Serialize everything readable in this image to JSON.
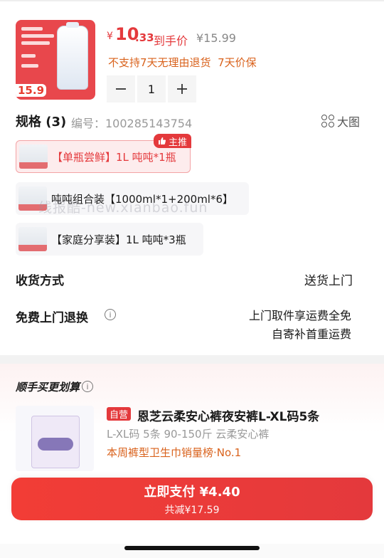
{
  "product": {
    "price_currency": "¥",
    "price_int": "10",
    "price_dec": ".33",
    "price_label": "到手价",
    "orig_price": "¥15.99",
    "tags": "不支持7天无理由退货  7天价保",
    "thumb_price": "15.9",
    "quantity": "1"
  },
  "spec": {
    "title": "规格 (3)",
    "code": "编号：100285143754",
    "big_image_label": "大图",
    "main_badge": "主推",
    "options": [
      {
        "label": "【单瓶尝鲜】1L 吨吨*1瓶"
      },
      {
        "label": "吨吨组合装【1000ml*1+200ml*6】"
      },
      {
        "label": "【家庭分享装】1L 吨吨*3瓶"
      }
    ],
    "watermark": "线报酷-new.xianbao.fun"
  },
  "delivery": {
    "label": "收货方式",
    "value": "送货上门"
  },
  "returns": {
    "label": "免费上门退换",
    "line1": "上门取件享运费全免",
    "line2": "自寄补首重运费"
  },
  "recommend": {
    "title": "顺手买更划算",
    "self_badge": "自营",
    "name": "恩芝云柔安心裤夜安裤L-XL码5条",
    "spec": "L-XL码 5条 90-150斤 云柔安心裤",
    "rank": "本周裤型卫生巾销量榜·No.1"
  },
  "pay": {
    "main": "立即支付 ¥4.40",
    "sub": "共减¥17.59"
  },
  "colors": {
    "accent": "#e4393c",
    "tag_orange": "#d9621c"
  }
}
